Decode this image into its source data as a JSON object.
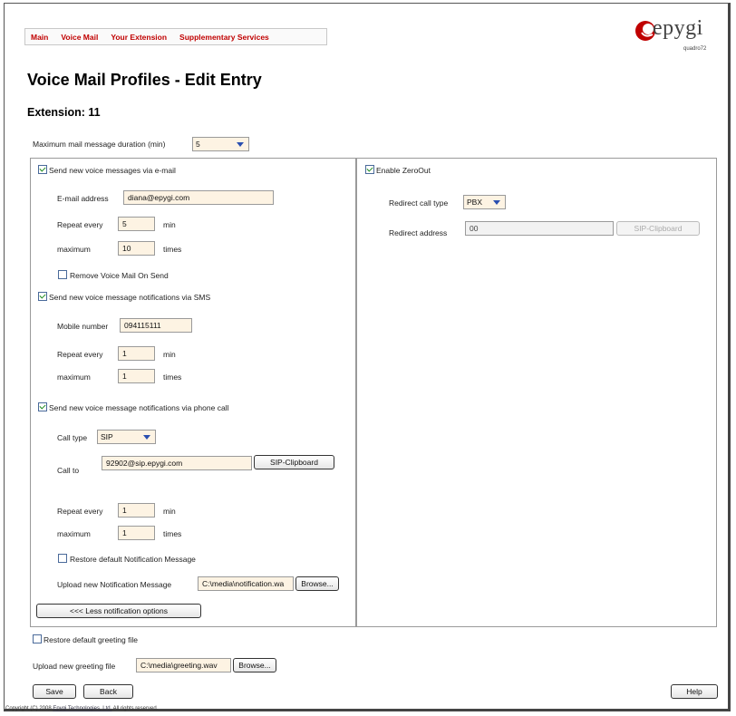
{
  "nav": {
    "items": [
      "Main",
      "Voice Mail",
      "Your Extension",
      "Supplementary Services"
    ]
  },
  "logo": {
    "word": "epygi",
    "model": "quadro72"
  },
  "page": {
    "title": "Voice Mail Profiles - Edit Entry",
    "extension": "Extension: 11"
  },
  "max_duration": {
    "label": "Maximum mail message duration (min)",
    "value": "5"
  },
  "email": {
    "checkbox_label": "Send new voice messages via e-mail",
    "checked": true,
    "address_label": "E-mail address",
    "address_value": "diana@epygi.com",
    "repeat_label": "Repeat every",
    "repeat_value": "5",
    "repeat_unit": "min",
    "max_label": "maximum",
    "max_value": "10",
    "max_unit": "times",
    "remove_label": "Remove Voice Mail On Send",
    "remove_checked": false
  },
  "sms": {
    "checkbox_label": "Send new voice message notifications via SMS",
    "checked": true,
    "mobile_label": "Mobile number",
    "mobile_value": "094115111",
    "repeat_label": "Repeat every",
    "repeat_value": "1",
    "repeat_unit": "min",
    "max_label": "maximum",
    "max_value": "1",
    "max_unit": "times"
  },
  "phone": {
    "checkbox_label": "Send new voice message notifications via phone call",
    "checked": true,
    "call_type_label": "Call type",
    "call_type_value": "SIP",
    "call_to_label": "Call to",
    "call_to_value": "92902@sip.epygi.com",
    "clipboard_label": "SIP-Clipboard",
    "repeat_label": "Repeat every",
    "repeat_value": "1",
    "repeat_unit": "min",
    "max_label": "maximum",
    "max_value": "1",
    "max_unit": "times",
    "restore_label": "Restore default Notification Message",
    "restore_checked": false,
    "upload_label": "Upload new Notification Message",
    "upload_value": "C:\\media\\notification.wa",
    "browse_label": "Browse..."
  },
  "less_options_label": "<<< Less notification options",
  "zeroout": {
    "checkbox_label": "Enable ZeroOut",
    "checked": true,
    "redirect_type_label": "Redirect call type",
    "redirect_type_value": "PBX",
    "redirect_address_label": "Redirect address",
    "redirect_address_value": "00",
    "clipboard_label": "SIP-Clipboard"
  },
  "greeting": {
    "restore_label": "Restore default greeting file",
    "restore_checked": false,
    "upload_label": "Upload new greeting file",
    "upload_value": "C:\\media\\greeting.wav",
    "browse_label": "Browse..."
  },
  "actions": {
    "save": "Save",
    "back": "Back",
    "help": "Help"
  },
  "footer": {
    "prefix": "Copyright (C) 2008 ",
    "company": "Epygi Technologies, Ltd.",
    "suffix": " All rights reserved."
  },
  "colors": {
    "nav_text": "#c00000",
    "field_bg": "#fdf3e3",
    "check_mark": "#1a8a1a",
    "dropdown_arrow": "#2a4fb0"
  }
}
